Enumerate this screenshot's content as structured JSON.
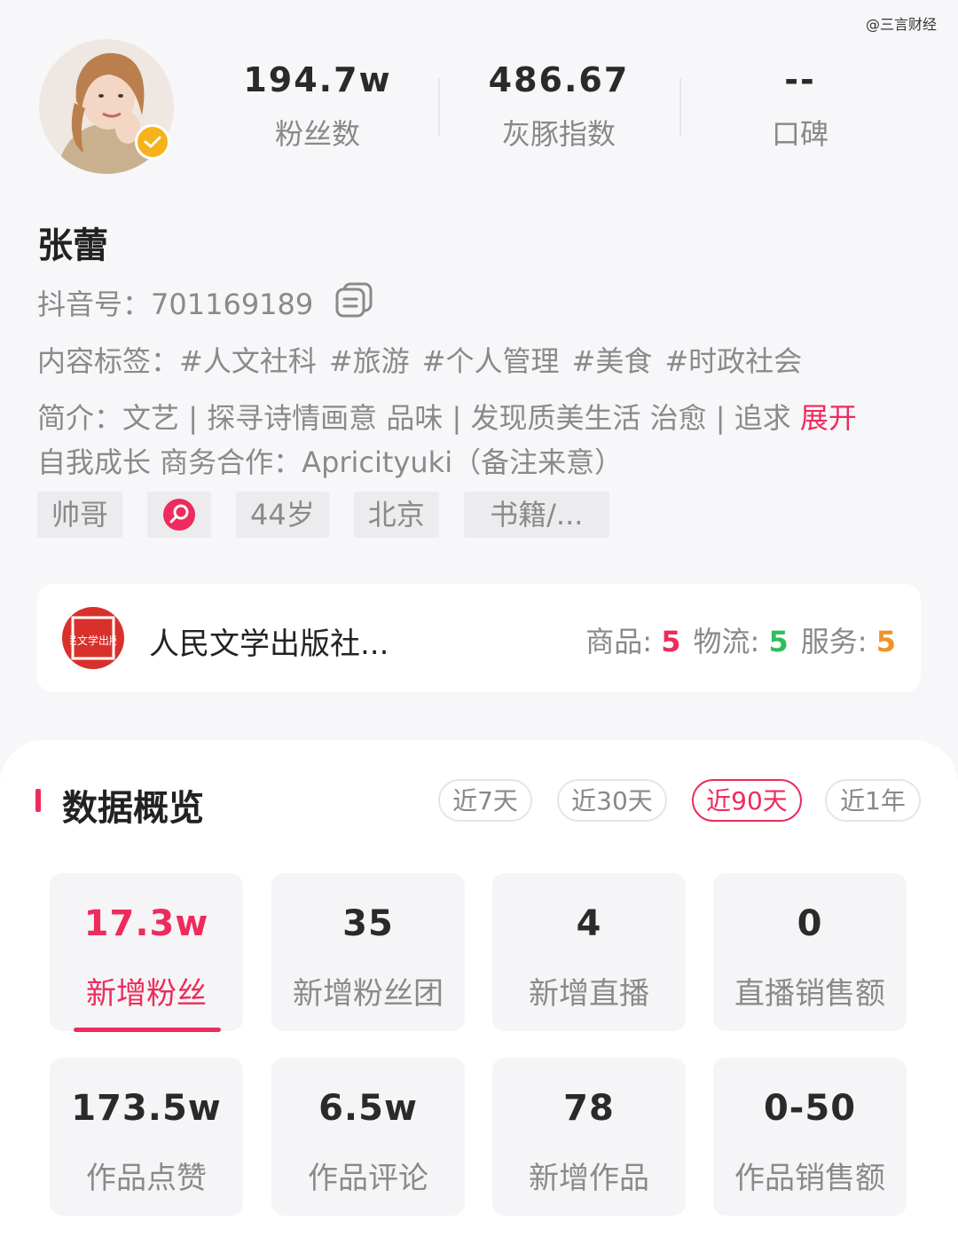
{
  "watermark": "@三言财经",
  "profile": {
    "name": "张蕾",
    "stats": [
      {
        "value": "194.7w",
        "label": "粉丝数"
      },
      {
        "value": "486.67",
        "label": "灰豚指数"
      },
      {
        "value": "--",
        "label": "口碑"
      }
    ],
    "douyin_id_label": "抖音号：",
    "douyin_id": "701169189",
    "tags_label": "内容标签：",
    "tags": [
      "#人文社科",
      "#旅游",
      "#个人管理",
      "#美食",
      "#时政社会"
    ],
    "bio_label": "简介：",
    "bio_line1": "文艺 | 探寻诗情画意 品味 | 发现质美生活 治愈 | 追求",
    "expand": "展开",
    "bio_line2": "自我成长 商务合作：Apricityuki（备注来意）",
    "chips": [
      "帅哥",
      "44岁",
      "北京",
      "书籍/..."
    ]
  },
  "shop": {
    "name": "人民文学出版社...",
    "logo_text": "人民文学出版社",
    "scores": [
      {
        "label": "商品:",
        "value": "5",
        "color": "#ee2b5c"
      },
      {
        "label": "物流:",
        "value": "5",
        "color": "#2fbf5a"
      },
      {
        "label": "服务:",
        "value": "5",
        "color": "#f0932b"
      }
    ]
  },
  "overview": {
    "title": "数据概览",
    "ranges": [
      "近7天",
      "近30天",
      "近90天",
      "近1年"
    ],
    "active_range": "近90天",
    "metrics": [
      {
        "value": "17.3w",
        "label": "新增粉丝"
      },
      {
        "value": "35",
        "label": "新增粉丝团"
      },
      {
        "value": "4",
        "label": "新增直播"
      },
      {
        "value": "0",
        "label": "直播销售额"
      },
      {
        "value": "173.5w",
        "label": "作品点赞"
      },
      {
        "value": "6.5w",
        "label": "作品评论"
      },
      {
        "value": "78",
        "label": "新增作品"
      },
      {
        "value": "0-50",
        "label": "作品销售额"
      }
    ],
    "active_metric": "新增粉丝"
  },
  "colors": {
    "accent": "#ee2b5c",
    "verified": "#f6b21a"
  }
}
